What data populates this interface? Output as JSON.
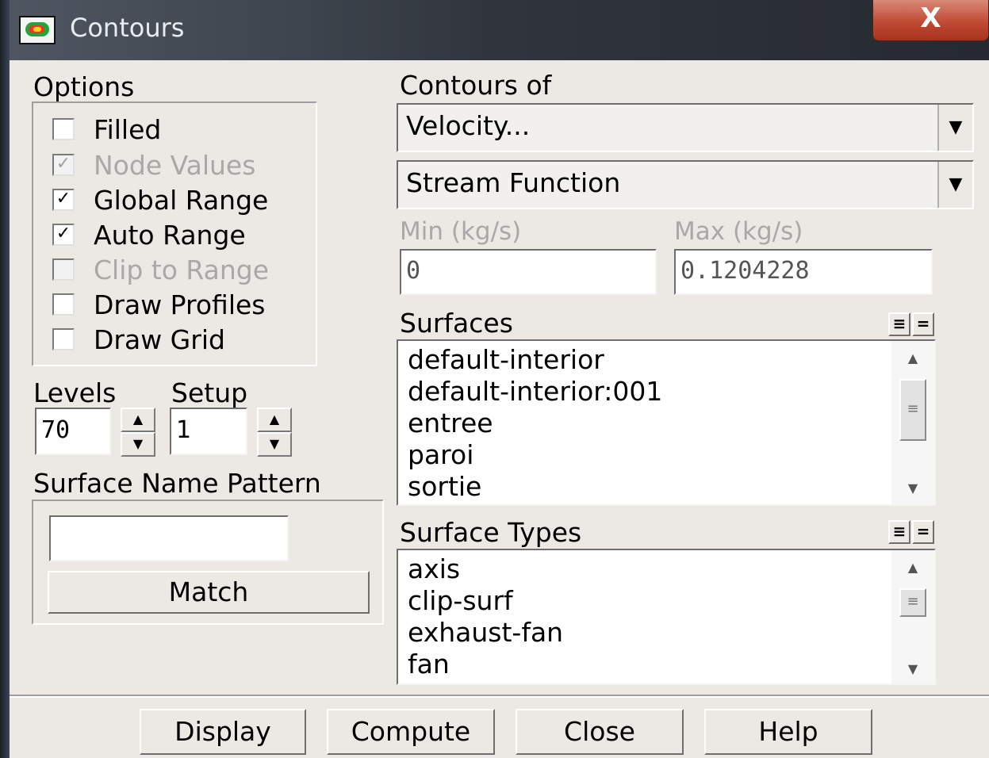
{
  "window": {
    "title": "Contours",
    "close_symbol": "X",
    "icon": "contour-plot-icon"
  },
  "options": {
    "heading": "Options",
    "items": [
      {
        "label": "Filled",
        "checked": false,
        "enabled": true
      },
      {
        "label": "Node Values",
        "checked": true,
        "enabled": false
      },
      {
        "label": "Global Range",
        "checked": true,
        "enabled": true
      },
      {
        "label": "Auto Range",
        "checked": true,
        "enabled": true
      },
      {
        "label": "Clip to Range",
        "checked": false,
        "enabled": false
      },
      {
        "label": "Draw Profiles",
        "checked": false,
        "enabled": true
      },
      {
        "label": "Draw Grid",
        "checked": false,
        "enabled": true
      }
    ]
  },
  "levels": {
    "label": "Levels",
    "value": "70"
  },
  "setup": {
    "label": "Setup",
    "value": "1"
  },
  "surface_name_pattern": {
    "label": "Surface Name Pattern",
    "value": "",
    "match_label": "Match"
  },
  "contours_of": {
    "label": "Contours of",
    "category": "Velocity...",
    "quantity": "Stream Function"
  },
  "range": {
    "min_label": "Min (kg/s)",
    "min_value": "0",
    "max_label": "Max (kg/s)",
    "max_value": "0.1204228"
  },
  "surfaces": {
    "label": "Surfaces",
    "select_all_symbol": "≡",
    "deselect_symbol": "=",
    "items": [
      "default-interior",
      "default-interior:001",
      "entree",
      "paroi",
      "sortie"
    ]
  },
  "surface_types": {
    "label": "Surface Types",
    "select_all_symbol": "≡",
    "deselect_symbol": "=",
    "items": [
      "axis",
      "clip-surf",
      "exhaust-fan",
      "fan"
    ]
  },
  "buttons": {
    "display": "Display",
    "compute": "Compute",
    "close": "Close",
    "help": "Help"
  },
  "colors": {
    "dialog_bg": "#ece9e4",
    "titlebar": "#3e444d",
    "close_button": "#c04a33"
  }
}
